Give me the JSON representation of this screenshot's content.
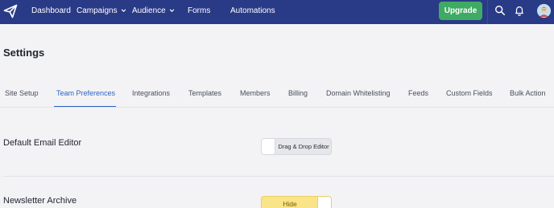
{
  "nav": {
    "items": [
      {
        "label": "Dashboard",
        "has_dropdown": false
      },
      {
        "label": "Campaigns",
        "has_dropdown": true
      },
      {
        "label": "Audience",
        "has_dropdown": true
      },
      {
        "label": "Forms",
        "has_dropdown": false
      },
      {
        "label": "Automations",
        "has_dropdown": false
      }
    ],
    "upgrade_label": "Upgrade",
    "icons": [
      "paper-plane-logo-icon",
      "search-icon",
      "bell-icon",
      "avatar"
    ]
  },
  "page": {
    "title": "Settings"
  },
  "tabs": [
    {
      "label": "Site Setup",
      "active": false
    },
    {
      "label": "Team Preferences",
      "active": true
    },
    {
      "label": "Integrations",
      "active": false
    },
    {
      "label": "Templates",
      "active": false
    },
    {
      "label": "Members",
      "active": false
    },
    {
      "label": "Billing",
      "active": false
    },
    {
      "label": "Domain Whitelisting",
      "active": false
    },
    {
      "label": "Feeds",
      "active": false
    },
    {
      "label": "Custom Fields",
      "active": false
    },
    {
      "label": "Bulk Action",
      "active": false
    }
  ],
  "settings": {
    "default_email_editor": {
      "label": "Default Email Editor",
      "toggle_value": "Drag & Drop Editor"
    },
    "newsletter_archive": {
      "label": "Newsletter Archive",
      "toggle_value": "Hide"
    }
  },
  "colors": {
    "nav_bg": "#293a86",
    "accent": "#2f63c6",
    "upgrade": "#3faa63",
    "hide_toggle": "#f9e48a"
  }
}
